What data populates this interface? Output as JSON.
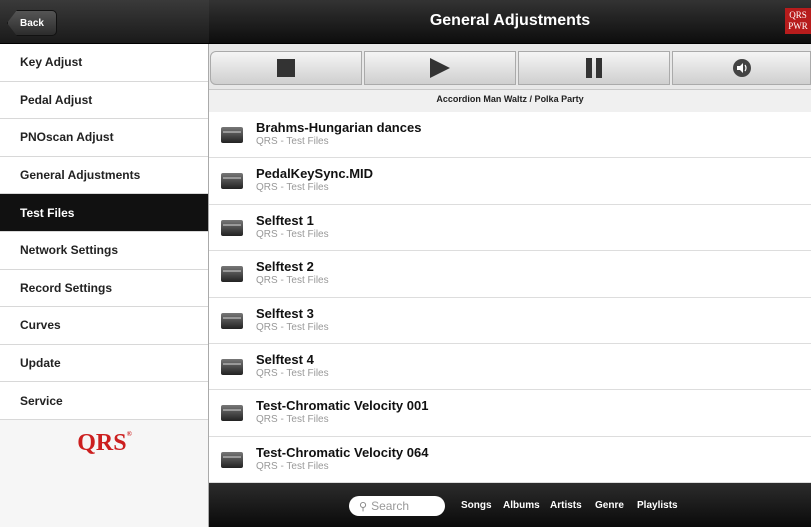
{
  "header": {
    "back_label": "Back",
    "title": "General Adjustments",
    "badge_line1": "QRS",
    "badge_line2": "PWR"
  },
  "sidebar": {
    "items": [
      {
        "label": "Key Adjust"
      },
      {
        "label": "Pedal Adjust"
      },
      {
        "label": "PNOscan Adjust"
      },
      {
        "label": "General Adjustments"
      },
      {
        "label": "Test Files"
      },
      {
        "label": "Network Settings"
      },
      {
        "label": "Record Settings"
      },
      {
        "label": "Curves"
      },
      {
        "label": "Update"
      },
      {
        "label": "Service"
      }
    ],
    "logo_text": "QRS",
    "active_index": 4
  },
  "transport": {
    "buttons": [
      "stop-icon",
      "play-icon",
      "pause-icon",
      "volume-icon"
    ],
    "now_playing": "Accordion Man Waltz / Polka Party"
  },
  "files": [
    {
      "title": "Brahms-Hungarian dances",
      "subtitle": "QRS - Test Files"
    },
    {
      "title": "PedalKeySync.MID",
      "subtitle": "QRS - Test Files"
    },
    {
      "title": "Selftest 1",
      "subtitle": "QRS - Test Files"
    },
    {
      "title": "Selftest 2",
      "subtitle": "QRS - Test Files"
    },
    {
      "title": "Selftest 3",
      "subtitle": "QRS - Test Files"
    },
    {
      "title": "Selftest 4",
      "subtitle": "QRS - Test Files"
    },
    {
      "title": "Test-Chromatic Velocity 001",
      "subtitle": "QRS - Test Files"
    },
    {
      "title": "Test-Chromatic Velocity 064",
      "subtitle": "QRS - Test Files"
    }
  ],
  "bottom_bar": {
    "search_placeholder": "Search",
    "filters": [
      "Songs",
      "Albums",
      "Artists",
      "Genre",
      "Playlists"
    ]
  },
  "colors": {
    "active_bg": "#111111",
    "logo_red": "#cc1f1f"
  }
}
